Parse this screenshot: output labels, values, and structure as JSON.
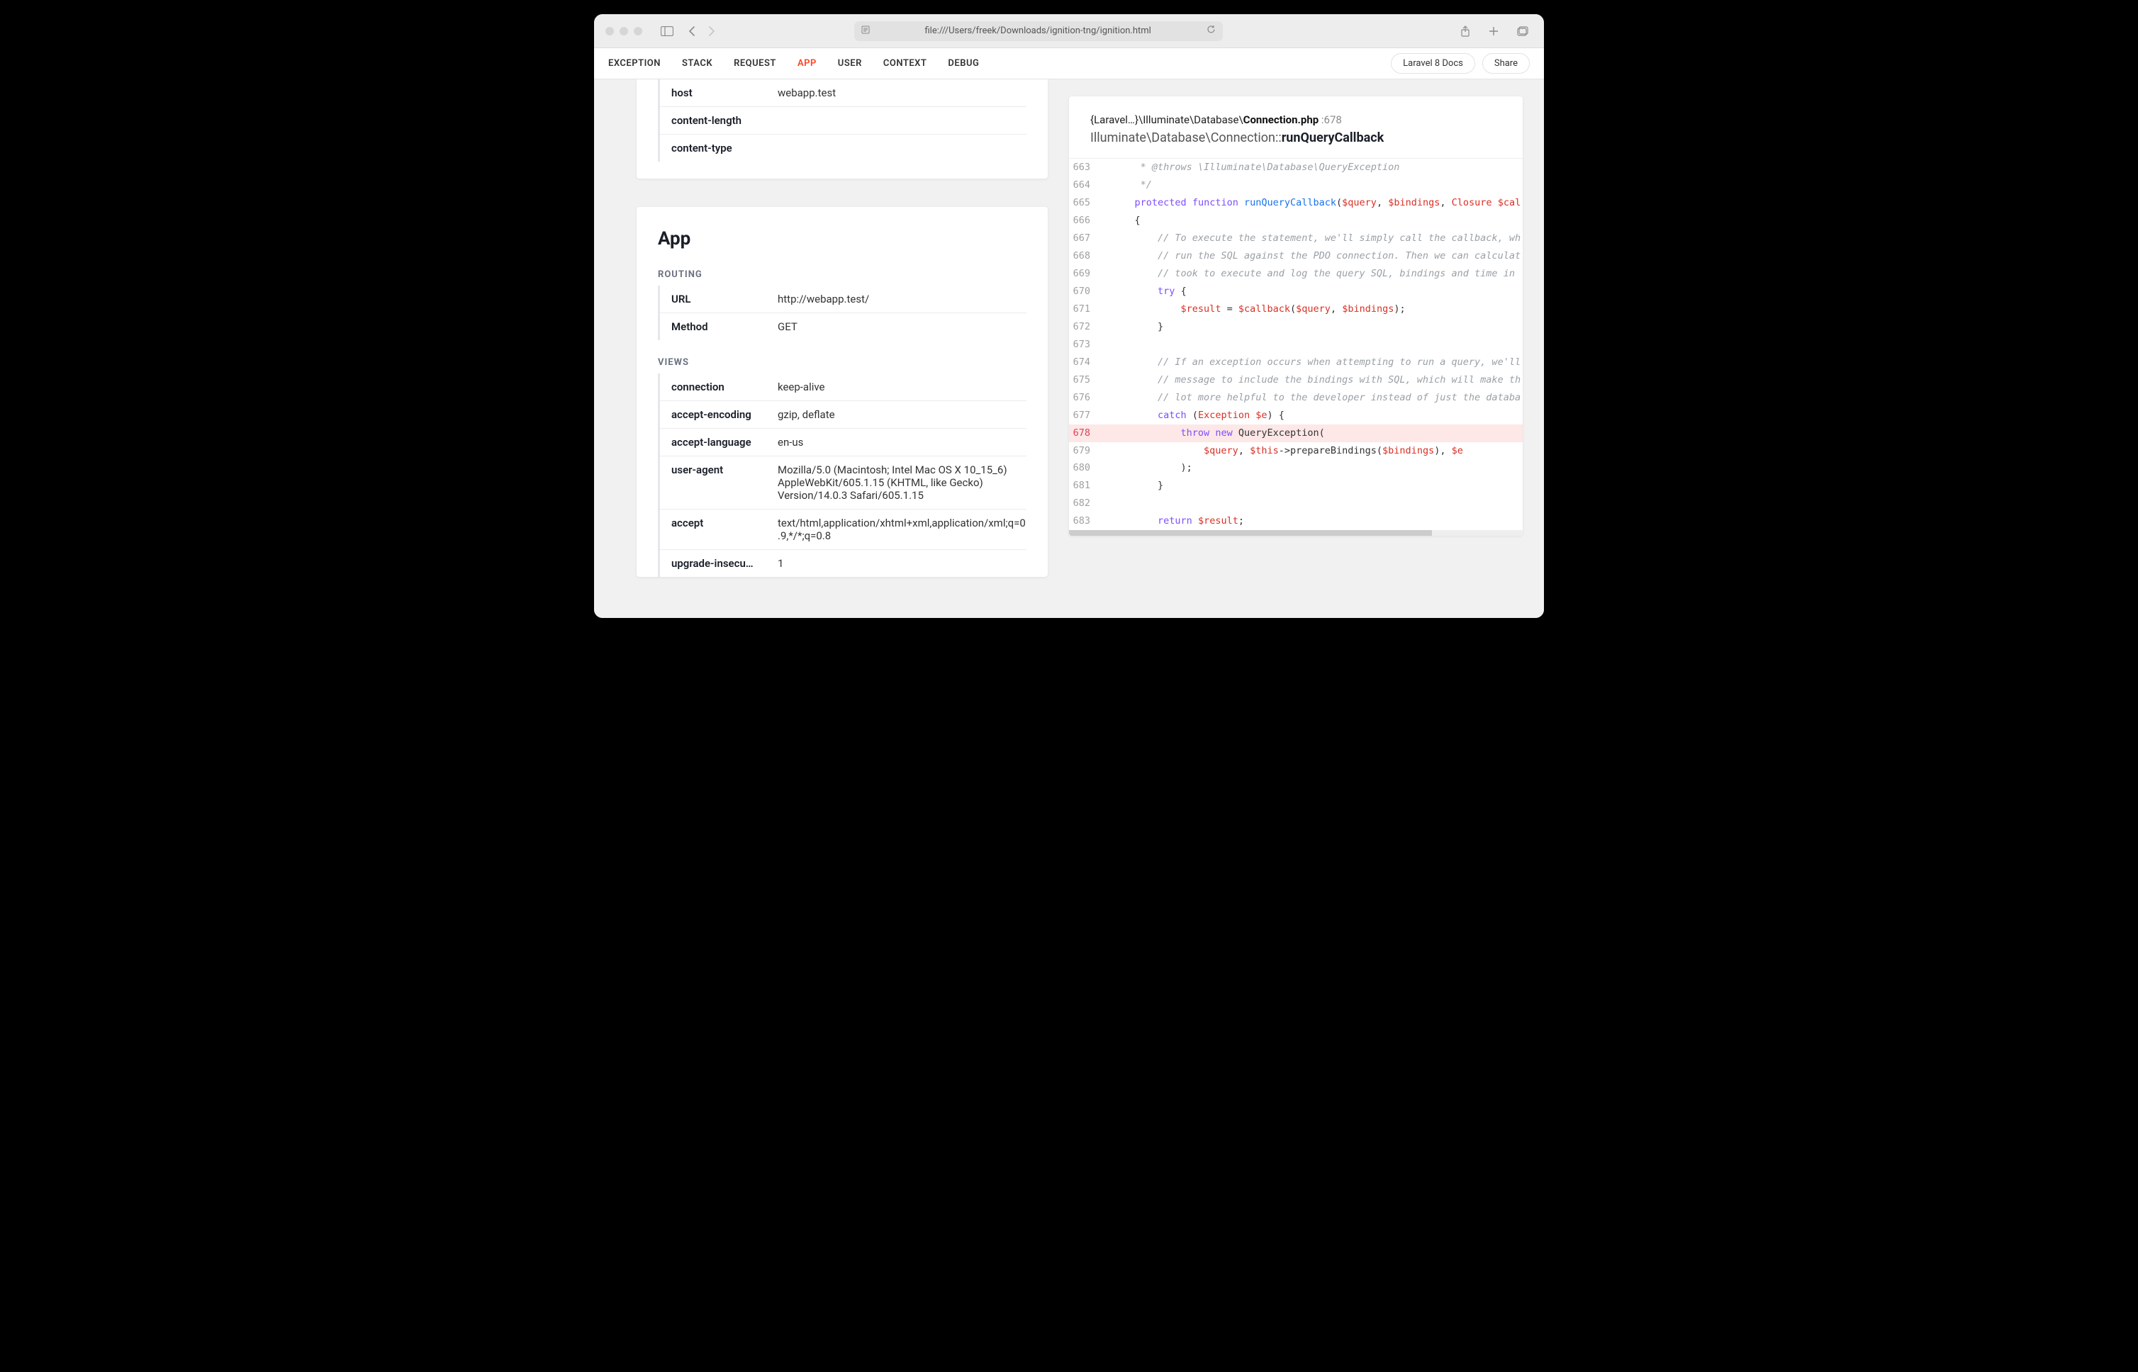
{
  "browser": {
    "url": "file:///Users/freek/Downloads/ignition-tng/ignition.html"
  },
  "nav": {
    "tabs": [
      "EXCEPTION",
      "STACK",
      "REQUEST",
      "APP",
      "USER",
      "CONTEXT",
      "DEBUG"
    ],
    "active": "APP",
    "docs": "Laravel 8 Docs",
    "share": "Share"
  },
  "headers_top": [
    {
      "k": "host",
      "v": "webapp.test"
    },
    {
      "k": "content-length",
      "v": ""
    },
    {
      "k": "content-type",
      "v": ""
    }
  ],
  "app": {
    "title": "App",
    "routing_label": "ROUTING",
    "routing": [
      {
        "k": "URL",
        "v": "http://webapp.test/"
      },
      {
        "k": "Method",
        "v": "GET"
      }
    ],
    "views_label": "VIEWS",
    "views": [
      {
        "k": "connection",
        "v": "keep-alive"
      },
      {
        "k": "accept-encoding",
        "v": "gzip, deflate"
      },
      {
        "k": "accept-language",
        "v": "en-us"
      },
      {
        "k": "user-agent",
        "v": "Mozilla/5.0 (Macintosh; Intel Mac OS X 10_15_6) AppleWebKit/605.1.15 (KHTML, like Gecko) Version/14.0.3 Safari/605.1.15"
      },
      {
        "k": "accept",
        "v": "text/html,application/xhtml+xml,application/xml;q=0.9,*/*;q=0.8"
      },
      {
        "k": "upgrade-insecu…",
        "v": "1"
      }
    ]
  },
  "code": {
    "path_prefix": "{Laravel…}\\Illuminate\\Database\\",
    "filename": "Connection.php",
    "line_label": " :678",
    "namespace": "Illuminate\\Database\\Connection",
    "sep": "::",
    "method": "runQueryCallback",
    "highlight": 678,
    "lines": [
      {
        "n": 663,
        "html": "     <span class='tok-c'>* @throws \\Illuminate\\Database\\QueryException</span>"
      },
      {
        "n": 664,
        "html": "     <span class='tok-c'>*/</span>"
      },
      {
        "n": 665,
        "html": "    <span class='tok-k'>protected</span> <span class='tok-k'>function</span> <span class='tok-f'>runQueryCallback</span><span class='tok-p'>(</span><span class='tok-v'>$query</span><span class='tok-p'>, </span><span class='tok-v'>$bindings</span><span class='tok-p'>, </span><span class='tok-cls'>Closure</span> <span class='tok-v'>$cal</span>"
      },
      {
        "n": 666,
        "html": "    <span class='tok-p'>{</span>"
      },
      {
        "n": 667,
        "html": "        <span class='tok-c'>// To execute the statement, we'll simply call the callback, wh</span>"
      },
      {
        "n": 668,
        "html": "        <span class='tok-c'>// run the SQL against the PDO connection. Then we can calculat</span>"
      },
      {
        "n": 669,
        "html": "        <span class='tok-c'>// took to execute and log the query SQL, bindings and time in </span>"
      },
      {
        "n": 670,
        "html": "        <span class='tok-k'>try</span> <span class='tok-p'>{</span>"
      },
      {
        "n": 671,
        "html": "            <span class='tok-v'>$result</span> <span class='tok-p'>=</span> <span class='tok-v'>$callback</span><span class='tok-p'>(</span><span class='tok-v'>$query</span><span class='tok-p'>, </span><span class='tok-v'>$bindings</span><span class='tok-p'>);</span>"
      },
      {
        "n": 672,
        "html": "        <span class='tok-p'>}</span>"
      },
      {
        "n": 673,
        "html": ""
      },
      {
        "n": 674,
        "html": "        <span class='tok-c'>// If an exception occurs when attempting to run a query, we'll</span>"
      },
      {
        "n": 675,
        "html": "        <span class='tok-c'>// message to include the bindings with SQL, which will make th</span>"
      },
      {
        "n": 676,
        "html": "        <span class='tok-c'>// lot more helpful to the developer instead of just the databa</span>"
      },
      {
        "n": 677,
        "html": "        <span class='tok-k'>catch</span> <span class='tok-p'>(</span><span class='tok-cls'>Exception</span> <span class='tok-v'>$e</span><span class='tok-p'>) {</span>"
      },
      {
        "n": 678,
        "html": "            <span class='tok-k'>throw</span> <span class='tok-k'>new</span> <span class='tok-p'>QueryException(</span>"
      },
      {
        "n": 679,
        "html": "                <span class='tok-v'>$query</span><span class='tok-p'>, </span><span class='tok-v'>$this</span><span class='tok-p'>-&gt;prepareBindings(</span><span class='tok-v'>$bindings</span><span class='tok-p'>), </span><span class='tok-v'>$e</span>"
      },
      {
        "n": 680,
        "html": "            <span class='tok-p'>);</span>"
      },
      {
        "n": 681,
        "html": "        <span class='tok-p'>}</span>"
      },
      {
        "n": 682,
        "html": ""
      },
      {
        "n": 683,
        "html": "        <span class='tok-k'>return</span> <span class='tok-v'>$result</span><span class='tok-p'>;</span>"
      }
    ]
  }
}
